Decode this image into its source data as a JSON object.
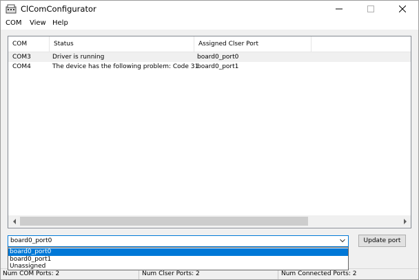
{
  "window": {
    "title": "ClComConfigurator"
  },
  "menu": [
    "COM",
    "View",
    "Help"
  ],
  "table": {
    "columns": [
      "COM",
      "Status",
      "Assigned Clser Port"
    ],
    "rows": [
      [
        "COM3",
        "Driver is running",
        "board0_port0"
      ],
      [
        "COM4",
        "The device has the following problem: Code 31",
        "board0_port1"
      ]
    ]
  },
  "port_select": {
    "value": "board0_port0",
    "options": [
      "board0_port0",
      "board0_port1",
      "Unassigned"
    ],
    "highlighted": "board0_port0"
  },
  "update_button": "Update port",
  "status": {
    "com_ports": "Num COM Ports: 2",
    "clser_ports": "Num Clser Ports: 2",
    "connected_ports": "Num Connected Ports: 2"
  },
  "colors": {
    "selection": "#0078d7",
    "scroll_thumb": "#cdcdcd"
  },
  "icons": {
    "app": "serial-port-icon",
    "minimize": "minimize-icon",
    "maximize": "maximize-icon",
    "close": "close-icon",
    "dropdown": "chevron-down-icon",
    "scroll_left": "chevron-left-icon",
    "scroll_right": "chevron-right-icon"
  }
}
